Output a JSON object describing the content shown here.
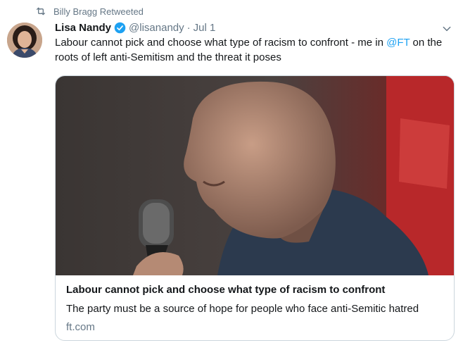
{
  "retweet": {
    "icon": "retweet-icon",
    "text": "Billy Bragg Retweeted"
  },
  "author": {
    "name": "Lisa Nandy",
    "handle": "@lisanandy",
    "separator": "·",
    "date": "Jul 1"
  },
  "tweet": {
    "text_before": "Labour cannot pick and choose what type of racism to confront - me in ",
    "mention": "@FT",
    "text_after": " on the roots of left anti-Semitism and the threat it poses"
  },
  "card": {
    "image": "speaker-photo",
    "title": "Labour cannot pick and choose what type of racism to confront",
    "description": "The party must be a source of hope for people who face anti-Semitic hatred",
    "domain": "ft.com"
  },
  "colors": {
    "link": "#1da1f2",
    "muted": "#657786",
    "border": "#ccd6dd"
  }
}
